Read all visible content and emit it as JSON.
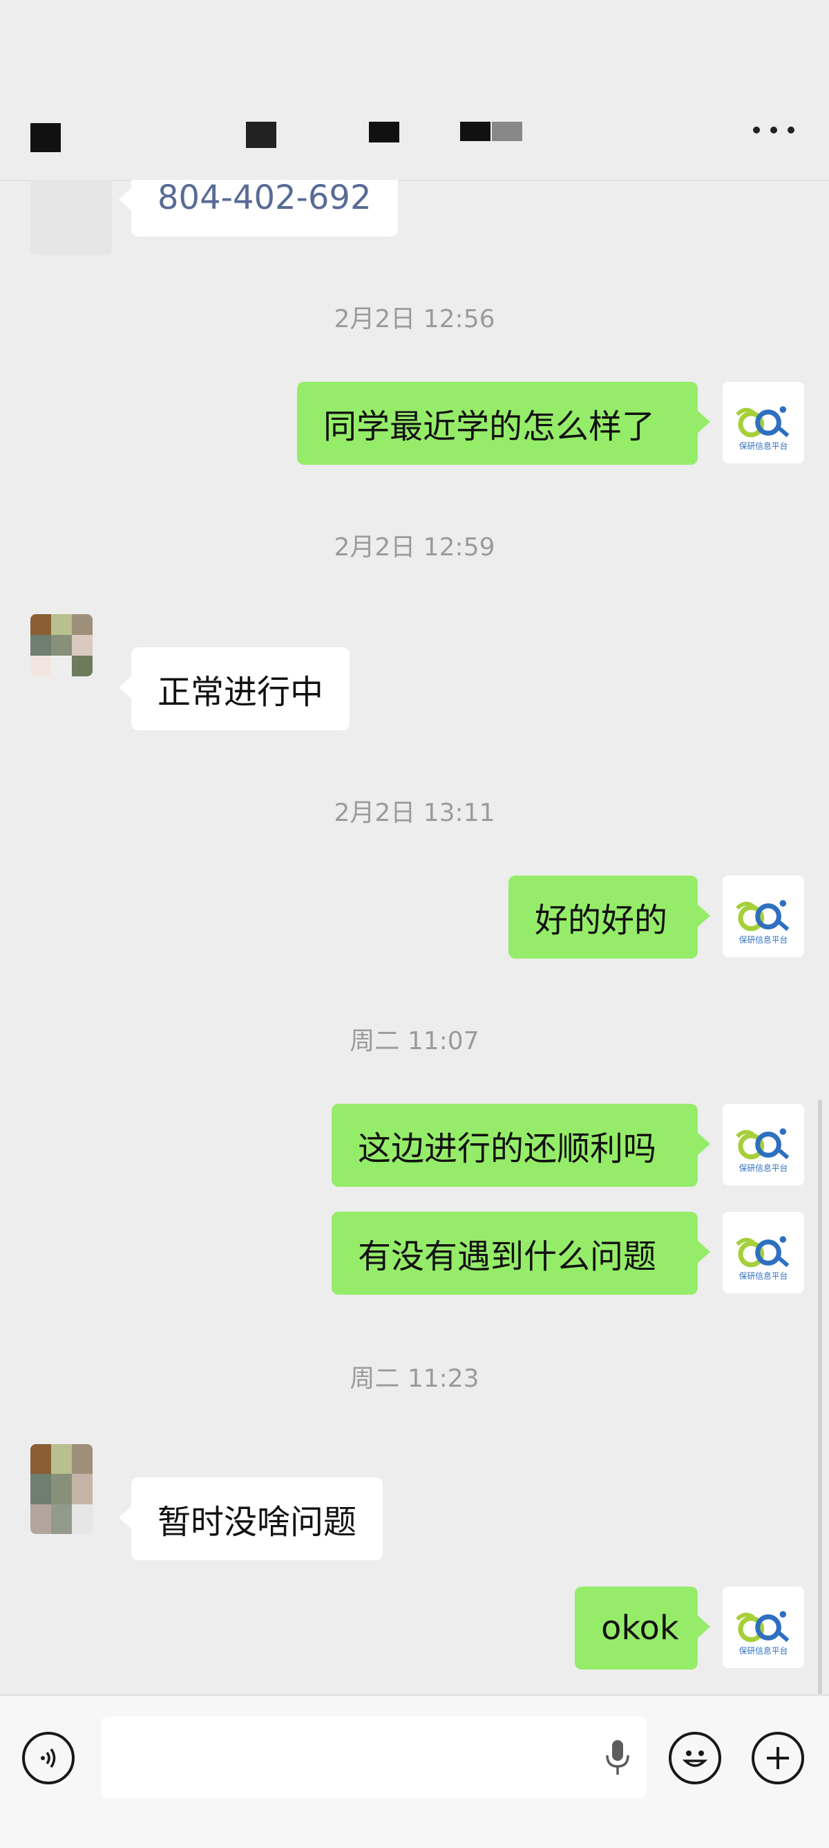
{
  "header": {
    "title_redacted": true,
    "more_icon": "more-icon"
  },
  "messages": [
    {
      "type": "text",
      "side": "other",
      "text": "804-402-692",
      "style": "phone"
    },
    {
      "type": "time",
      "text": "2月2日 12:56"
    },
    {
      "type": "text",
      "side": "me",
      "text": "同学最近学的怎么样了"
    },
    {
      "type": "time",
      "text": "2月2日 12:59"
    },
    {
      "type": "text",
      "side": "other",
      "text": "正常进行中"
    },
    {
      "type": "time",
      "text": "2月2日 13:11"
    },
    {
      "type": "text",
      "side": "me",
      "text": "好的好的"
    },
    {
      "type": "time",
      "text": "周二 11:07"
    },
    {
      "type": "text",
      "side": "me",
      "text": "这边进行的还顺利吗"
    },
    {
      "type": "text",
      "side": "me",
      "text": "有没有遇到什么问题"
    },
    {
      "type": "time",
      "text": "周二 11:23"
    },
    {
      "type": "text",
      "side": "other",
      "text": "暂时没啥问题"
    },
    {
      "type": "text",
      "side": "me",
      "text": "okok"
    }
  ],
  "my_avatar": {
    "logo_text": "保研信息平台",
    "colors": {
      "green": "#a6cf3a",
      "blue": "#2e6fc0"
    }
  },
  "bottom": {
    "voice_icon": "voice-icon",
    "mic_icon": "mic-icon",
    "emoji_icon": "emoji-icon",
    "plus_icon": "plus-icon"
  },
  "colors": {
    "background": "#ededed",
    "my_bubble": "#95ec69",
    "other_bubble": "#ffffff",
    "timestamp": "#9b9b9b",
    "phone_link": "#576b95"
  }
}
